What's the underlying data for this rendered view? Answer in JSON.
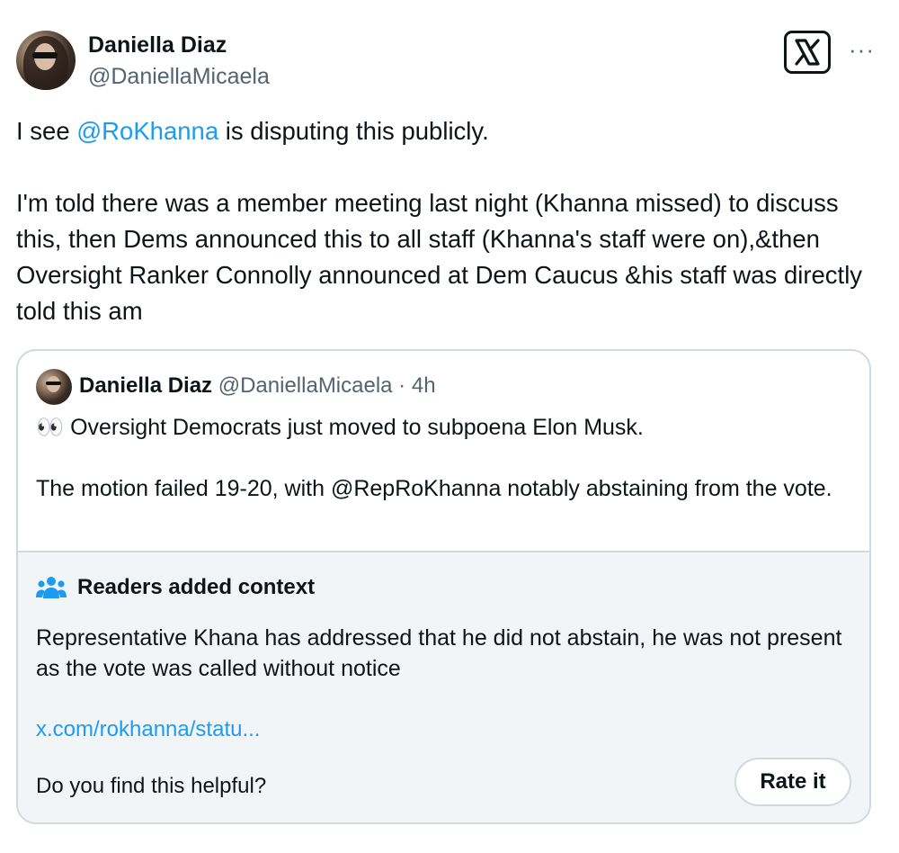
{
  "author": {
    "display_name": "Daniella Diaz",
    "handle": "@DaniellaMicaela"
  },
  "icons": {
    "x_logo": "x-logo-icon",
    "more": "more-icon",
    "readers_context": "people-icon"
  },
  "more_glyph": "···",
  "tweet": {
    "line1_prefix": "I see ",
    "line1_mention": "@RoKhanna",
    "line1_suffix": " is disputing this publicly.",
    "paragraph2": "I'm told there was a member meeting last night (Khanna missed) to discuss this, then Dems announced this to all staff (Khanna's staff were on),&then Oversight Ranker Connolly announced at Dem Caucus &his staff was directly told this am"
  },
  "quote": {
    "display_name": "Daniella Diaz",
    "handle": "@DaniellaMicaela",
    "separator": " · ",
    "time": "4h",
    "text_line1": "👀 Oversight Democrats just moved to subpoena Elon Musk.",
    "text_paragraph2": "The motion failed 19-20, with @RepRoKhanna notably abstaining from the vote."
  },
  "context": {
    "title": "Readers added context",
    "body": "Representative Khana has addressed that he did not abstain, he was not present as the vote was called without notice",
    "link": "x.com/rokhanna/statu...",
    "question": "Do you find this helpful?",
    "rate_label": "Rate it"
  },
  "colors": {
    "link_blue": "#1d9bf0",
    "text": "#0f1419",
    "muted": "#536471",
    "border": "#cfd9de",
    "context_bg": "#f2f5f7"
  }
}
